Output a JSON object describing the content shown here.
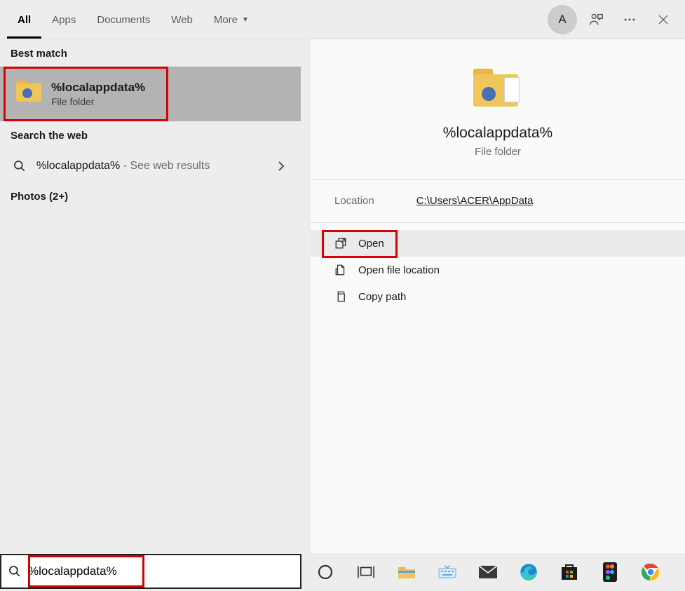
{
  "avatar_initial": "A",
  "tabs": {
    "all": "All",
    "apps": "Apps",
    "documents": "Documents",
    "web": "Web",
    "more": "More"
  },
  "left": {
    "best_match_header": "Best match",
    "best_match": {
      "title": "%localappdata%",
      "subtitle": "File folder"
    },
    "search_web_header": "Search the web",
    "web_result": {
      "term": "%localappdata%",
      "hint": " - See web results"
    },
    "photos_header": "Photos (2+)"
  },
  "detail": {
    "title": "%localappdata%",
    "subtitle": "File folder",
    "location_label": "Location",
    "location_value": "C:\\Users\\ACER\\AppData",
    "actions": {
      "open": "Open",
      "open_location": "Open file location",
      "copy_path": "Copy path"
    }
  },
  "search": {
    "value": "%localappdata%"
  }
}
